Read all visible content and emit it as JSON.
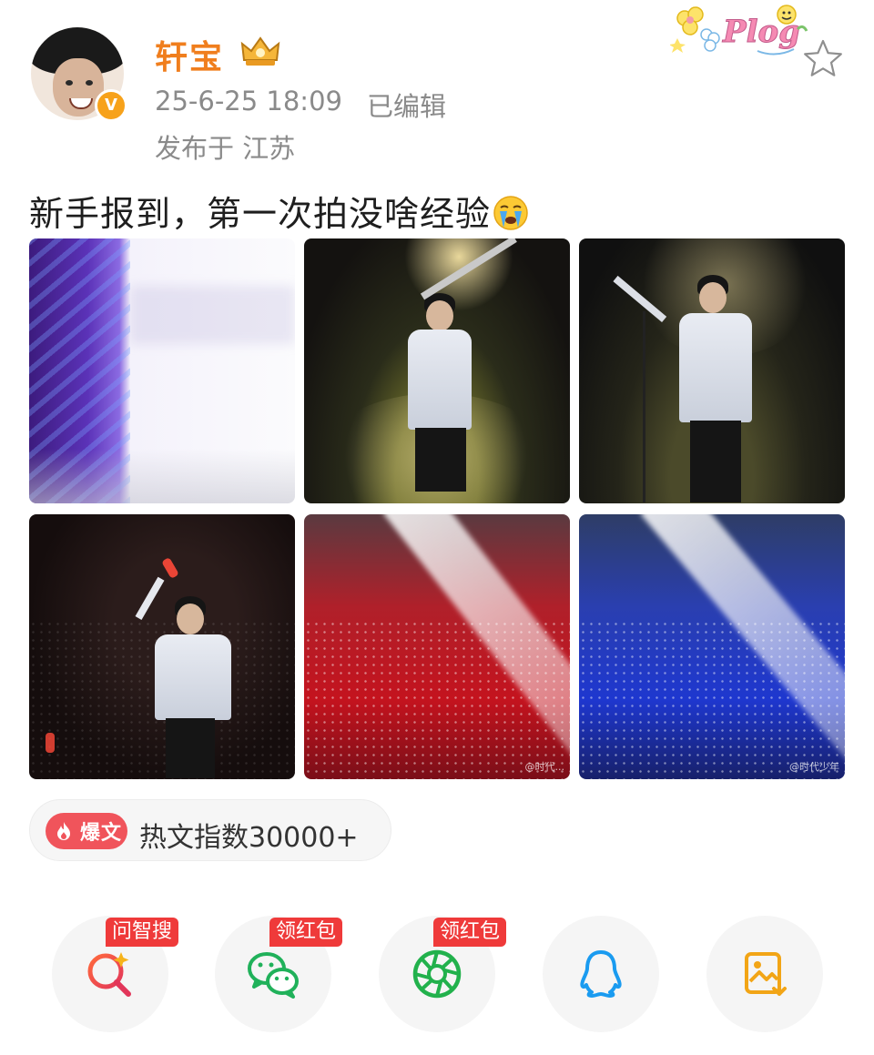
{
  "header": {
    "username": "轩宝",
    "verified_badge": "V",
    "time": "25-6-25 18:09",
    "edited": "已编辑",
    "location": "发布于 江苏"
  },
  "icons": {
    "avatar": "avatar-photo",
    "crown": "crown-icon",
    "plog": "plog-sticker-icon",
    "star": "star-icon",
    "emoji": "crying-face-emoji"
  },
  "post": {
    "text": "新手报到，第一次拍没啥经验"
  },
  "photos": [
    {
      "desc": "blurred-purple-stage"
    },
    {
      "desc": "guitarist-on-stage"
    },
    {
      "desc": "violinist-at-mic"
    },
    {
      "desc": "singer-pointing-up"
    },
    {
      "desc": "arena-red-lights",
      "watermark": "@时代..."
    },
    {
      "desc": "arena-blue-lights",
      "watermark": "@时代少年"
    }
  ],
  "hot": {
    "tag": "爆文",
    "text": "热文指数30000+",
    "tag_color": "#f0545b"
  },
  "share": [
    {
      "name": "ask-search",
      "tag": "问智搜",
      "icon": "search-sparkle-icon"
    },
    {
      "name": "wechat",
      "tag": "领红包",
      "icon": "wechat-icon"
    },
    {
      "name": "moments",
      "tag": "领红包",
      "icon": "moments-shutter-icon"
    },
    {
      "name": "qq",
      "tag": "",
      "icon": "qq-penguin-icon"
    },
    {
      "name": "save-image",
      "tag": "",
      "icon": "save-image-icon"
    }
  ],
  "colors": {
    "username": "#f07e1d",
    "meta": "#8a8a8a",
    "share_tag": "#ef3a3a"
  }
}
